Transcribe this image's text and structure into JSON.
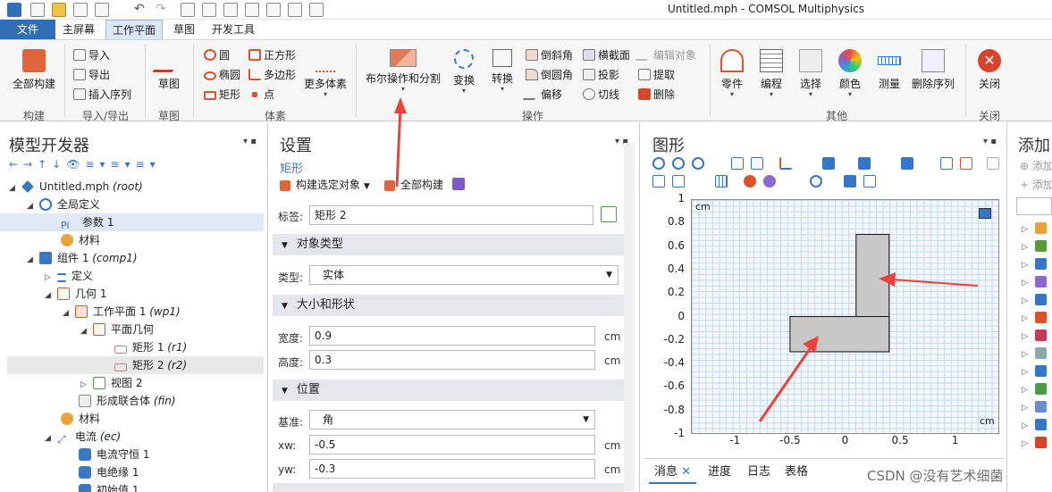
{
  "window": {
    "title": "Untitled.mph - COMSOL Multiphysics"
  },
  "tabs": [
    {
      "label": "文件"
    },
    {
      "label": "主屏幕"
    },
    {
      "label": "工作平面"
    },
    {
      "label": "草图"
    },
    {
      "label": "开发工具"
    }
  ],
  "ribbon": {
    "groups": {
      "build": "构建",
      "import_export": "导入/导出",
      "sketch": "草图",
      "primitives": "体素",
      "operations": "操作",
      "other": "其他",
      "close": "关闭"
    },
    "build_all": "全部构建",
    "import": "导入",
    "export": "导出",
    "insert_sequence": "插入序列",
    "sketch": "草图",
    "circle": "圆",
    "ellipse": "椭圆",
    "rectangle": "矩形",
    "square": "正方形",
    "polygon": "多边形",
    "point": "点",
    "more_primitives": "更多体素",
    "boolean": "布尔操作和分割",
    "transform": "变换",
    "convert": "转换",
    "chamfer": "倒斜角",
    "fillet": "倒圆角",
    "offset": "偏移",
    "cross_section": "横截面",
    "projection": "投影",
    "tangent": "切线",
    "edit_object": "编辑对象",
    "extract": "提取",
    "delete": "删除",
    "parts": "零件",
    "programming": "编程",
    "selections": "选择",
    "colors": "颜色",
    "measure": "测量",
    "delete_sequence": "删除序列",
    "close": "关闭"
  },
  "model_builder": {
    "title": "模型开发器",
    "tree": [
      {
        "label": "Untitled.mph",
        "suffix": "(root)"
      },
      {
        "label": "全局定义",
        "suffix": ""
      },
      {
        "label": "参数 1",
        "suffix": ""
      },
      {
        "label": "材料",
        "suffix": ""
      },
      {
        "label": "组件 1",
        "suffix": "(comp1)"
      },
      {
        "label": "定义",
        "suffix": ""
      },
      {
        "label": "几何 1",
        "suffix": ""
      },
      {
        "label": "工作平面 1",
        "suffix": "(wp1)"
      },
      {
        "label": "平面几何",
        "suffix": ""
      },
      {
        "label": "矩形 1",
        "suffix": "(r1)"
      },
      {
        "label": "矩形 2",
        "suffix": "(r2)"
      },
      {
        "label": "视图 2",
        "suffix": ""
      },
      {
        "label": "形成联合体",
        "suffix": "(fin)"
      },
      {
        "label": "材料",
        "suffix": ""
      },
      {
        "label": "电流",
        "suffix": "(ec)"
      },
      {
        "label": "电流守恒 1",
        "suffix": ""
      },
      {
        "label": "电绝缘 1",
        "suffix": ""
      },
      {
        "label": "初始值 1",
        "suffix": ""
      }
    ]
  },
  "settings": {
    "title": "设置",
    "subtitle": "矩形",
    "build_selected": "构建选定对象",
    "build_all": "全部构建",
    "label_caption": "标签:",
    "label_value": "矩形 2",
    "sections": {
      "object_type": "对象类型",
      "size_shape": "大小和形状",
      "position": "位置"
    },
    "type_caption": "类型:",
    "type_value": "实体",
    "width_caption": "宽度:",
    "width_value": "0.9",
    "height_caption": "高度:",
    "height_value": "0.3",
    "unit": "cm",
    "base_caption": "基准:",
    "base_value": "角",
    "xw_caption": "xw:",
    "xw_value": "-0.5",
    "yw_caption": "yw:",
    "yw_value": "-0.3"
  },
  "graphics": {
    "title": "图形",
    "unit_label_top": "cm",
    "unit_label_bottom": "cm",
    "y_ticks": [
      "1",
      "0.8",
      "0.6",
      "0.4",
      "0.2",
      "0",
      "-0.2",
      "-0.4",
      "-0.6",
      "-0.8",
      "-1"
    ],
    "x_ticks": [
      "-1",
      "-0.5",
      "0",
      "0.5",
      "1"
    ],
    "xlim": [
      -1.4,
      1.4
    ],
    "ylim": [
      -1,
      1
    ],
    "shapes": [
      {
        "name": "rect-1",
        "x": 0.1,
        "y": -0.3,
        "w": 0.3,
        "h": 1.0
      },
      {
        "name": "rect-2",
        "x": -0.5,
        "y": -0.3,
        "w": 0.9,
        "h": 0.3
      }
    ]
  },
  "add_panel": {
    "title": "添加",
    "item1": "添加",
    "item2": "添加"
  },
  "bottom_tabs": [
    "消息",
    "进度",
    "日志",
    "表格"
  ],
  "watermark": "CSDN @没有艺术细菌"
}
